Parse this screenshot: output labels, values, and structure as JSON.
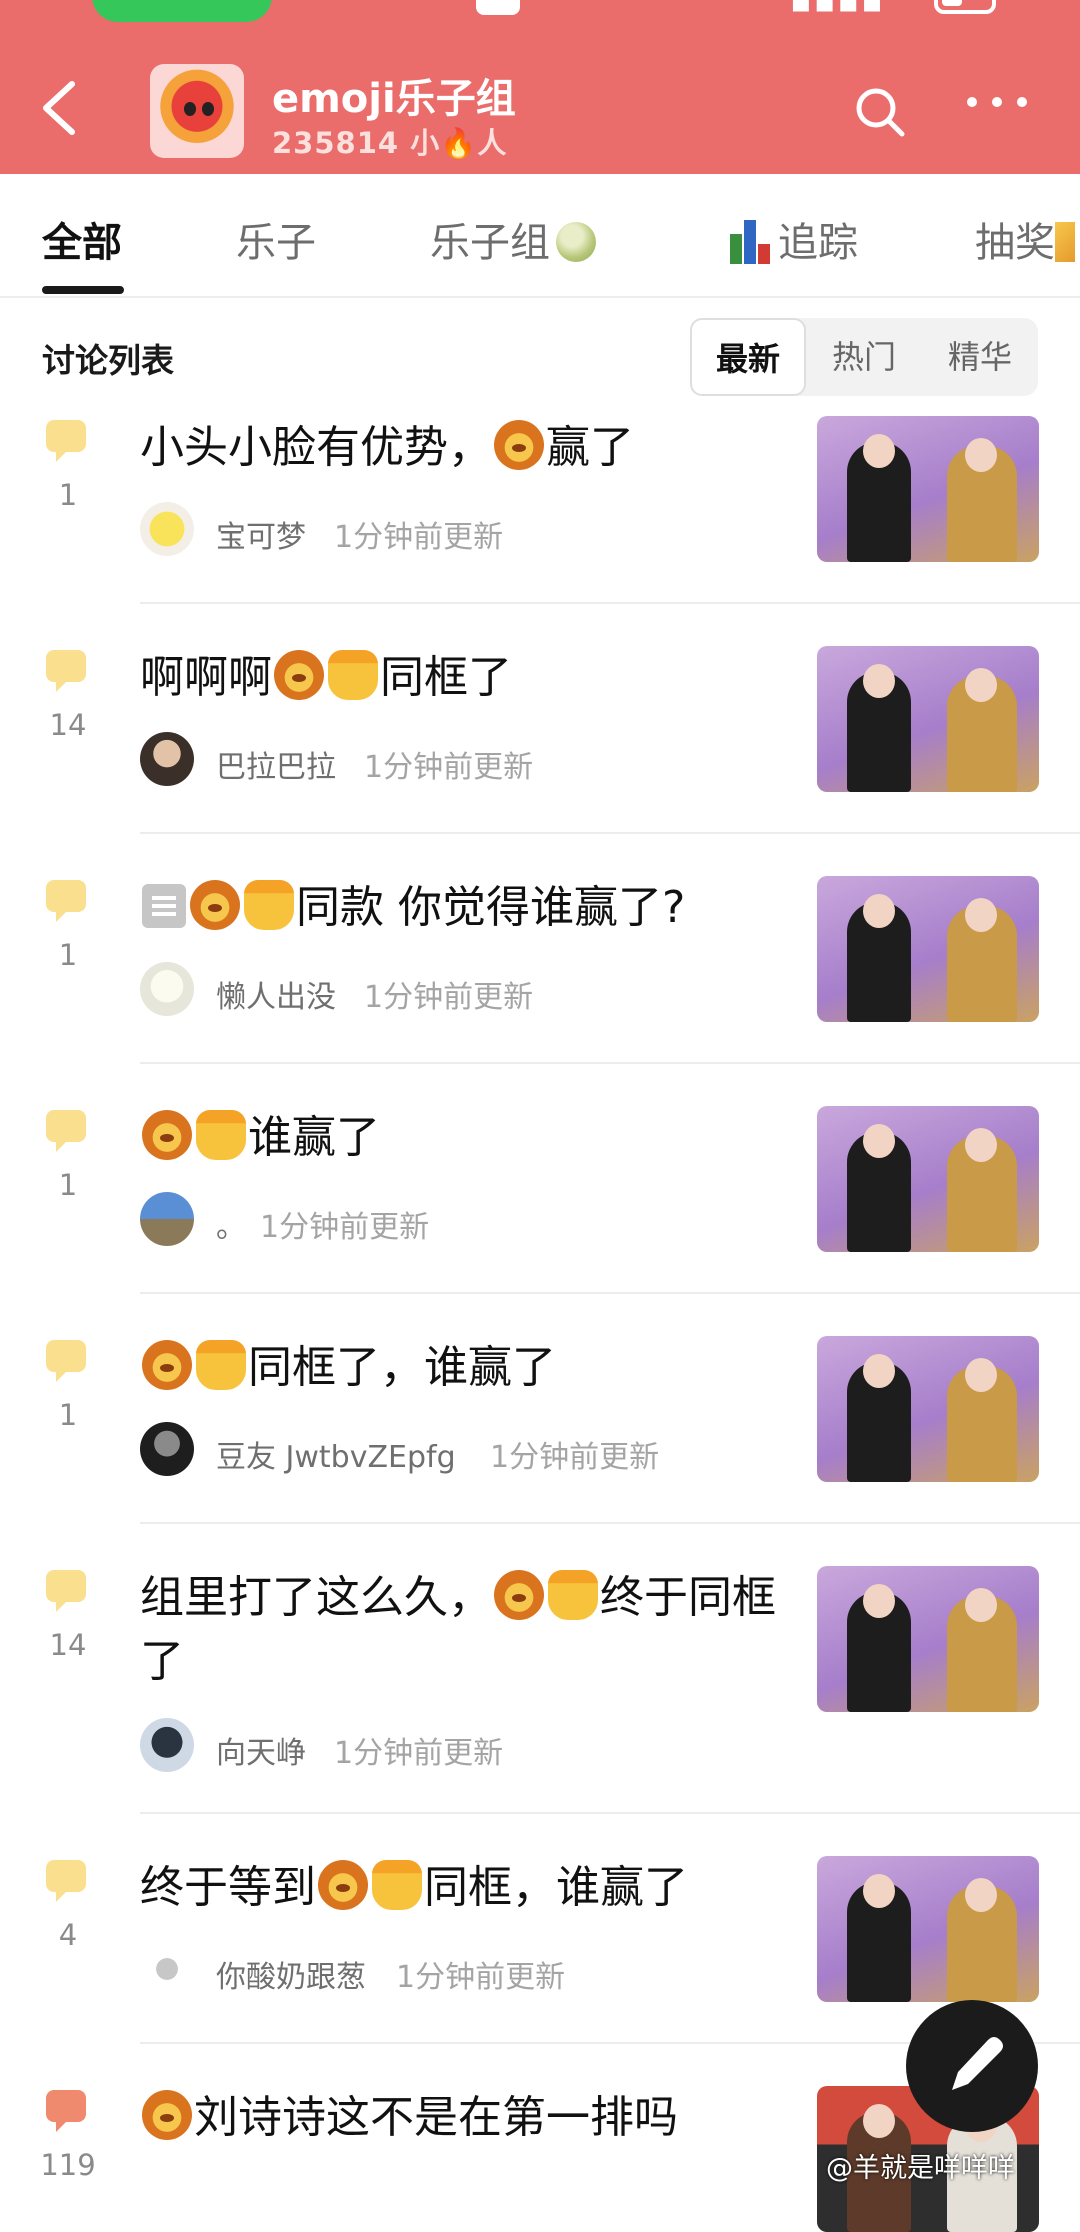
{
  "group": {
    "name": "emoji乐子组",
    "members_count": "235814",
    "members_label_prefix": "小",
    "members_label_suffix": "人"
  },
  "tabs": [
    {
      "label": "全部",
      "active": true
    },
    {
      "label": "乐子",
      "active": false
    },
    {
      "label": "乐子组",
      "active": false,
      "icon": "melon-icon"
    },
    {
      "label": "追踪",
      "active": false,
      "icon": "bar-chart-icon"
    },
    {
      "label": "抽奖",
      "active": false,
      "icon": "party-popper-icon"
    }
  ],
  "list": {
    "title": "讨论列表",
    "sort_options": [
      "最新",
      "热门",
      "精华"
    ],
    "selected_sort": "最新"
  },
  "posts": [
    {
      "count": "1",
      "title_before": "小头小脸有优势，",
      "title_after": "赢了",
      "author": "宝可梦",
      "time": "1分钟前更新"
    },
    {
      "count": "14",
      "title_before": "啊啊啊",
      "title_after": "同框了",
      "author": "巴拉巴拉",
      "time": "1分钟前更新"
    },
    {
      "count": "1",
      "title_before": "",
      "title_after": "同款 你觉得谁赢了?",
      "author": "懒人出没",
      "time": "1分钟前更新"
    },
    {
      "count": "1",
      "title_before": "",
      "title_after": "谁赢了",
      "author": "。",
      "time": "1分钟前更新"
    },
    {
      "count": "1",
      "title_before": "",
      "title_after": "同框了，谁赢了",
      "author": "豆友 JwtbvZEpfg",
      "time": "1分钟前更新"
    },
    {
      "count": "14",
      "title_before": "组里打了这么久，",
      "title_after": "终于同框了",
      "author": "向天峥",
      "time": "1分钟前更新"
    },
    {
      "count": "4",
      "title_before": "终于等到",
      "title_after": "同框，谁赢了",
      "author": "你酸奶跟葱",
      "time": "1分钟前更新"
    },
    {
      "count": "119",
      "title_before": "",
      "title_after": "刘诗诗这不是在第一排吗",
      "author": "",
      "time": ""
    }
  ],
  "watermark": "@羊就是咩咩咩",
  "colors": {
    "header_bg": "#ea6d6b",
    "accent": "#111111",
    "comment_bubble": "#fadf8f",
    "hot_bubble": "#f08a6f"
  }
}
